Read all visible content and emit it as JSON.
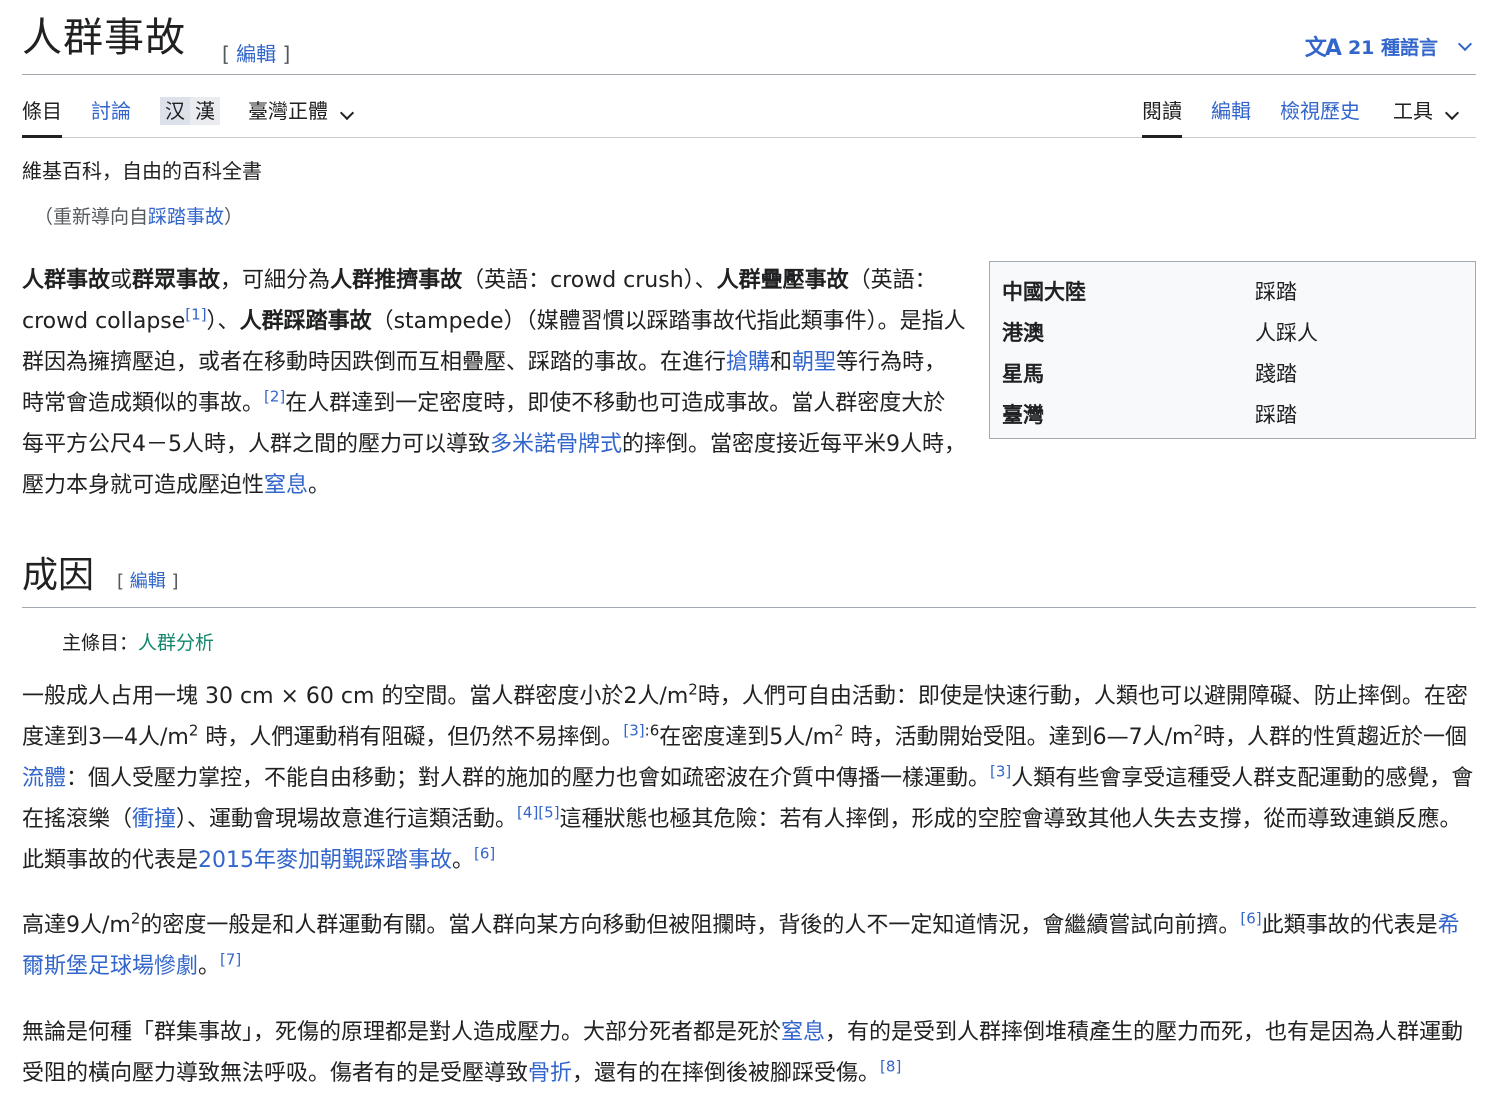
{
  "page": {
    "title": "人群事故",
    "edit_label": "編輯",
    "languages": "21 種語言",
    "lang_glyph": "文A"
  },
  "tabs": {
    "article": "條目",
    "talk": "討論",
    "variant_simplified": "汉",
    "variant_traditional": "漢",
    "variant_current": "臺灣正體",
    "read": "閱讀",
    "edit": "編輯",
    "history": "檢視歷史",
    "tools": "工具"
  },
  "tagline": "維基百科，自由的百科全書",
  "redirect": {
    "prefix": "（重新導向自",
    "link": "踩踏事故",
    "suffix": "）"
  },
  "lead": {
    "b1": "人群事故",
    "t1": "或",
    "b2": "群眾事故",
    "t2": "，可細分為",
    "b3": "人群推擠事故",
    "t3": "（英語：crowd crush）、",
    "b4": "人群疊壓事故",
    "t4": "（英語：crowd collapse",
    "r1": "[1]",
    "t5": "）、",
    "b5": "人群踩踏事故",
    "t6": "（stampede）（媒體習慣以踩踏事故代指此類事件）。是指人群因為擁擠壓迫，或者在移動時因跌倒而互相疊壓、踩踏的事故。在進行",
    "l1": "搶購",
    "t7": "和",
    "l2": "朝聖",
    "t8": "等行為時，時常會造成類似的事故。",
    "r2": "[2]",
    "t9": "在人群達到一定密度時，即使不移動也可造成事故。當人群密度大於每平方公尺4－5人時，人群之間的壓力可以導致",
    "l3": "多米諾骨牌式",
    "t10": "的摔倒。當密度接近每平米9人時，壓力本身就可造成壓迫性",
    "l4": "窒息",
    "t11": "。"
  },
  "infobox": [
    {
      "region": "中國大陸",
      "term": "踩踏"
    },
    {
      "region": "港澳",
      "term": "人踩人"
    },
    {
      "region": "星馬",
      "term": "踐踏"
    },
    {
      "region": "臺灣",
      "term": "踩踏"
    }
  ],
  "section": {
    "heading": "成因",
    "hatnote_prefix": "主條目：",
    "hatnote_link": "人群分析"
  },
  "p1": {
    "a": "一般成人占用一塊 30 cm × 60 cm 的空間。當人群密度小於2人/m",
    "sup1": "2",
    "b": "時，人們可自由活動：即使是快速行動，人類也可以避開障礙、防止摔倒。在密度達到3—4人/m",
    "sup2": "2",
    "c": " 時，人們運動稍有阻礙，但仍然不易摔倒。",
    "r1": "[3]",
    "r1b": ":6",
    "d": "在密度達到5人/m",
    "sup3": "2",
    "e": " 時，活動開始受阻。達到6—7人/m",
    "sup4": "2",
    "f": "時，人群的性質趨近於一個",
    "l1": "流體",
    "g": "：個人受壓力掌控，不能自由移動；對人群的施加的壓力也會如疏密波在介質中傳播一樣運動。",
    "r2": "[3]",
    "h": "人類有些會享受這種受人群支配運動的感覺，會在搖滾樂（",
    "l2": "衝撞",
    "i": "）、運動會現場故意進行這類活動。",
    "r3": "[4]",
    "r4": "[5]",
    "j": "這種狀態也極其危險：若有人摔倒，形成的空腔會導致其他人失去支撐，從而導致連鎖反應。此類事故的代表是",
    "l3": "2015年麥加朝覲踩踏事故",
    "k": "。",
    "r5": "[6]"
  },
  "p2": {
    "a": "高達9人/m",
    "sup1": "2",
    "b": "的密度一般是和人群運動有關。當人群向某方向移動但被阻攔時，背後的人不一定知道情況，會繼續嘗試向前擠。",
    "r1": "[6]",
    "c": "此類事故的代表是",
    "l1": "希爾斯堡足球場慘劇",
    "d": "。",
    "r2": "[7]"
  },
  "p3": {
    "a": "無論是何種「群集事故」，死傷的原理都是對人造成壓力。大部分死者都是死於",
    "l1": "窒息",
    "b": "，有的是受到人群摔倒堆積產生的壓力而死，也有是因為人群運動受阻的橫向壓力導致無法呼吸。傷者有的是受壓導致",
    "l2": "骨折",
    "c": "，還有的在摔倒後被腳踩受傷。",
    "r1": "[8]"
  }
}
